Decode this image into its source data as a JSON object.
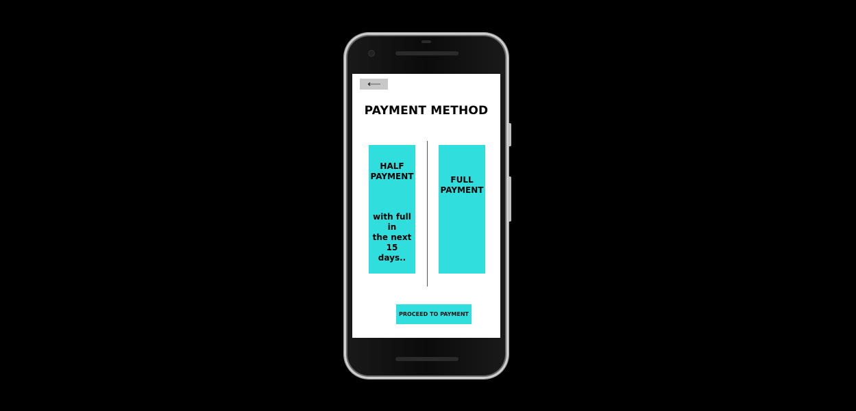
{
  "screen": {
    "back_button": {
      "icon": "arrow-left-icon"
    },
    "title": "PAYMENT METHOD",
    "options": [
      {
        "title_line1": "HALF",
        "title_line2": "PAYMENT",
        "sub_line1": "with full in",
        "sub_line2": "the next 15",
        "sub_line3": "days.."
      },
      {
        "title_line1": "FULL",
        "title_line2": "PAYMENT"
      }
    ],
    "proceed_label": "PROCEED TO PAYMENT"
  },
  "colors": {
    "background": "#000000",
    "screen": "#ffffff",
    "accent": "#30dede",
    "back_button": "#c8c8c8"
  }
}
